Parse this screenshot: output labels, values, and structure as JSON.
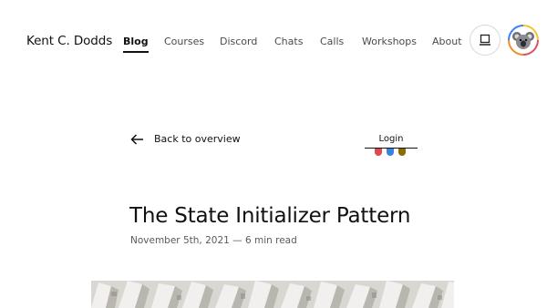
{
  "header": {
    "brand": "Kent C. Dodds",
    "nav": [
      {
        "label": "Blog",
        "active": true
      },
      {
        "label": "Courses",
        "active": false
      },
      {
        "label": "Discord",
        "active": false
      },
      {
        "label": "Chats",
        "active": false
      },
      {
        "label": "Calls",
        "active": false
      },
      {
        "label": "Workshops",
        "active": false
      },
      {
        "label": "About",
        "active": false
      }
    ],
    "theme_toggle_icon": "laptop-icon",
    "avatar_icon": "koala-avatar"
  },
  "article": {
    "back_label": "Back to overview",
    "title": "The State Initializer Pattern",
    "meta": "November 5th, 2021 — 6 min read"
  },
  "login_widget": {
    "label": "Login",
    "dot_colors": [
      "#e0494f",
      "#3b82e0",
      "#8a6d00"
    ]
  },
  "hero_image": {
    "description_icon": "geometric-building-facade"
  }
}
